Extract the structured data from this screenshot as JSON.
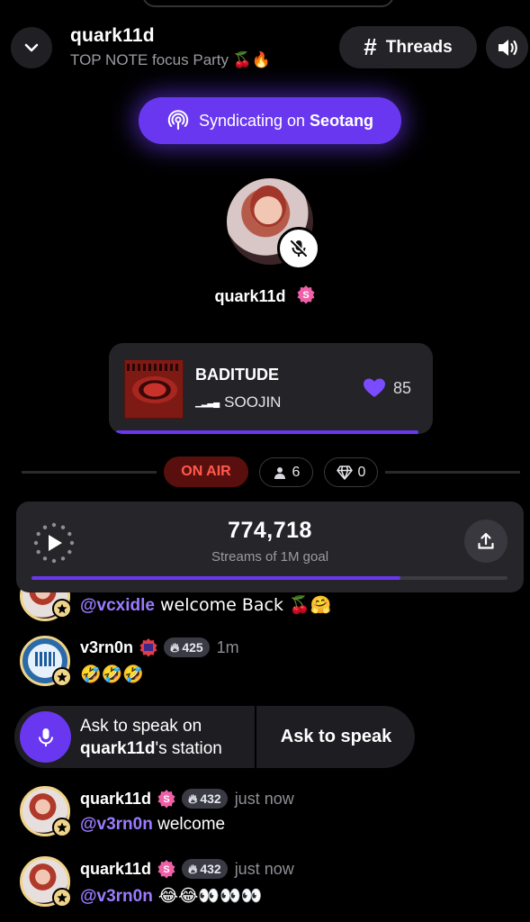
{
  "header": {
    "host_name": "quark11d",
    "subtitle": "TOP NOTE focus Party 🍒🔥",
    "threads_label": "Threads",
    "threads_icon": "hash-icon",
    "sound_icon": "speaker-icon"
  },
  "syndicate": {
    "prefix": "Syndicating on",
    "station": "Seotang",
    "icon": "broadcast-icon"
  },
  "host": {
    "name": "quark11d",
    "muted": true
  },
  "now_playing": {
    "title": "BADITUDE",
    "artist": "SOOJIN",
    "likes": "85",
    "accent": "#6a37f0"
  },
  "status": {
    "on_air": "ON AIR",
    "listeners": "6",
    "gems": "0"
  },
  "streams": {
    "count": "774,718",
    "label": "Streams of 1M goal",
    "progress": 0.774718
  },
  "chat": [
    {
      "mention": "@vcxidle",
      "text": " welcome Back 🍒🤗"
    },
    {
      "user": "v3rn0n",
      "score": "425",
      "time": "1m",
      "text": "🤣🤣🤣"
    },
    {
      "user": "quark11d",
      "score": "432",
      "time": "just now",
      "mention": "@v3rn0n",
      "text": " welcome"
    },
    {
      "user": "quark11d",
      "score": "432",
      "time": "just now",
      "mention": "@v3rn0n",
      "text": " 😂😂👀👀👀"
    }
  ],
  "ask_to_speak": {
    "line1": "Ask to speak on",
    "station_owner": "quark11d",
    "line2_suffix": "'s station",
    "button": "Ask to speak"
  },
  "colors": {
    "accent": "#6a37f0",
    "on_air_text": "#ff5b4a",
    "mention": "#9b7bff"
  }
}
